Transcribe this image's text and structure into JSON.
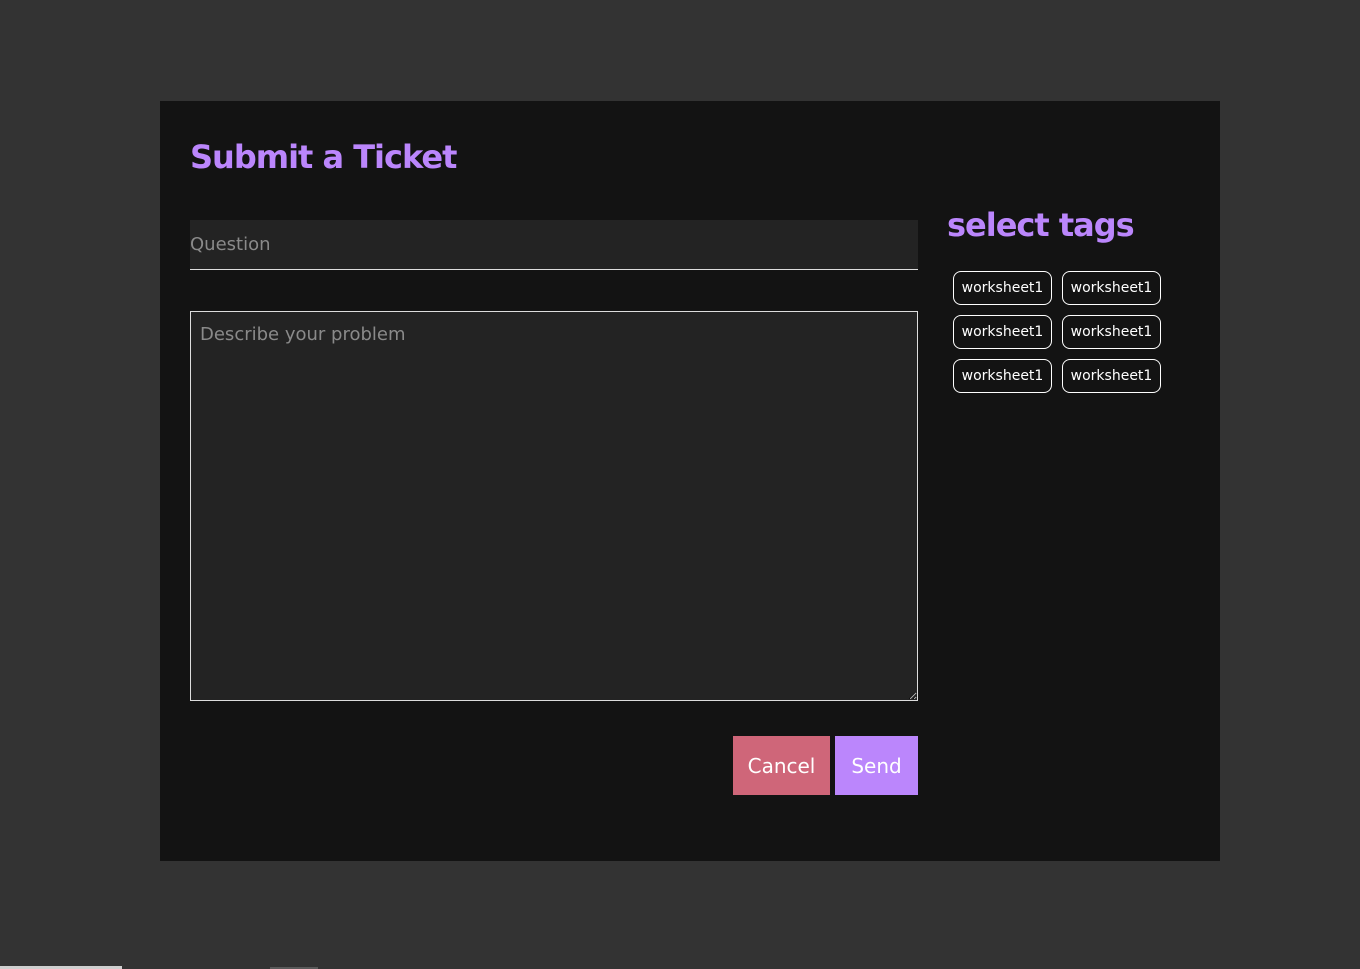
{
  "modal": {
    "title": "Submit a Ticket"
  },
  "form": {
    "question_placeholder": "Question",
    "question_value": "",
    "description_placeholder": "Describe your problem",
    "description_value": "",
    "cancel_label": "Cancel",
    "send_label": "Send"
  },
  "tags": {
    "heading": "select tags",
    "items": [
      {
        "label": "worksheet1"
      },
      {
        "label": "worksheet1"
      },
      {
        "label": "worksheet1"
      },
      {
        "label": "worksheet1"
      },
      {
        "label": "worksheet1"
      },
      {
        "label": "worksheet1"
      }
    ]
  },
  "colors": {
    "accent": "#bb86fc",
    "cancel": "#cf6679",
    "modal_bg": "#131313",
    "page_bg": "#333333",
    "input_bg": "#232323"
  }
}
